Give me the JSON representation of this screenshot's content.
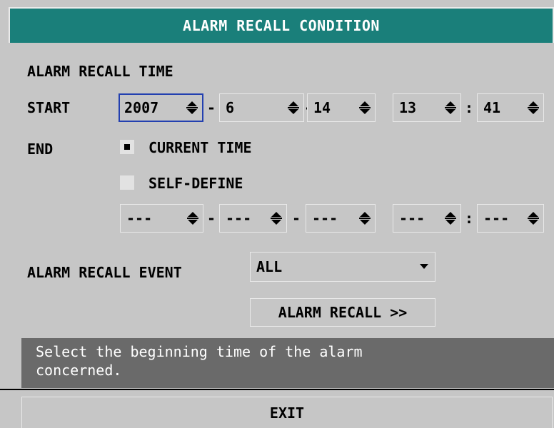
{
  "title": "ALARM RECALL CONDITION",
  "recall_time": {
    "heading": "ALARM RECALL TIME",
    "start_label": "START",
    "start": {
      "year": "2007",
      "month": "6",
      "day": "14",
      "hour": "13",
      "minute": "41"
    },
    "end_label": "END",
    "option_current": "CURRENT TIME",
    "option_self": "SELF-DEFINE",
    "selected_option": "CURRENT TIME",
    "self_define": {
      "year": "---",
      "month": "---",
      "day": "---",
      "hour": "---",
      "minute": "---"
    },
    "date_sep": "-",
    "time_sep": ":"
  },
  "recall_event": {
    "label": "ALARM RECALL EVENT",
    "value": "ALL"
  },
  "recall_button": "ALARM RECALL >>",
  "help_text": "Select the beginning time of the alarm\nconcerned.",
  "exit_button": "EXIT",
  "colors": {
    "title_bg": "#1a7f7a",
    "panel_bg": "#c6c6c6",
    "help_bg": "#6a6a6a",
    "focus_border": "#2340b0"
  },
  "icons": {
    "spinner": "up-down-arrow-icon",
    "dropdown": "chevron-down-icon"
  }
}
